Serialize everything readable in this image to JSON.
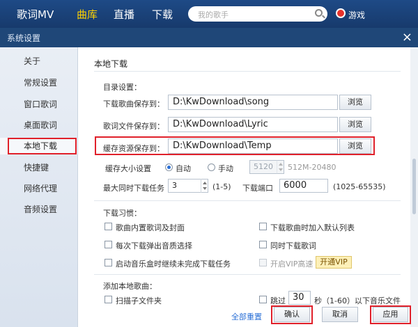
{
  "topnav": {
    "items": [
      "歌词MV",
      "曲库",
      "直播",
      "下载"
    ],
    "active_index": 1,
    "search_placeholder": "我的歌手",
    "game_label": "游戏"
  },
  "dialog": {
    "title": "系统设置",
    "close_glyph": "×"
  },
  "sidebar": {
    "items": [
      "关于",
      "常规设置",
      "窗口歌词",
      "桌面歌词",
      "本地下载",
      "快捷键",
      "网络代理",
      "音频设置"
    ],
    "active_index": 4
  },
  "main": {
    "section_title": "本地下载",
    "directory": {
      "title": "目录设置：",
      "rows": [
        {
          "label": "下载歌曲保存到：",
          "value": "D:\\KwDownload\\song",
          "button": "浏览"
        },
        {
          "label": "歌词文件保存到：",
          "value": "D:\\KwDownload\\Lyric",
          "button": "浏览"
        },
        {
          "label": "缓存资源保存到：",
          "value": "D:\\KwDownload\\Temp",
          "button": "浏览"
        }
      ]
    },
    "cache": {
      "label": "缓存大小设置",
      "auto": "自动",
      "manual": "手动",
      "manual_value": "5120",
      "range": "512M-20480"
    },
    "concurrency": {
      "label": "最大同时下载任务",
      "value": "3",
      "range": "(1-5)",
      "port_label": "下载端口",
      "port_value": "6000",
      "port_range": "(1025-65535)"
    },
    "habits": {
      "title": "下载习惯：",
      "options": [
        {
          "label": "歌曲内置歌词及封面",
          "checked": false,
          "disabled": false
        },
        {
          "label": "下载歌曲时加入默认列表",
          "checked": false,
          "disabled": false
        },
        {
          "label": "每次下载弹出音质选择",
          "checked": false,
          "disabled": false
        },
        {
          "label": "同时下载歌词",
          "checked": false,
          "disabled": false
        },
        {
          "label": "启动音乐盒时继续未完成下载任务",
          "checked": false,
          "disabled": false
        },
        {
          "label": "开启VIP高速",
          "checked": false,
          "disabled": true
        }
      ],
      "vip_button": "开通VIP"
    },
    "add_local": {
      "title": "添加本地歌曲：",
      "scan_label": "扫描子文件夹",
      "skip_label": "跳过",
      "skip_value": "30",
      "skip_suffix": "秒（1-60）以下音乐文件"
    }
  },
  "footer": {
    "reset": "全部重置",
    "confirm": "确认",
    "cancel": "取消",
    "apply": "应用"
  }
}
